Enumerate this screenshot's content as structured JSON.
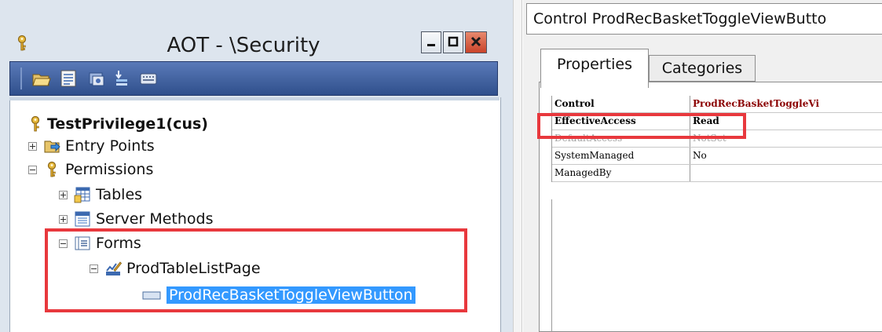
{
  "aot": {
    "title": "AOT - \\Security",
    "window_buttons": {
      "minimize": "minimize-icon",
      "maximize": "maximize-icon",
      "close": "close-icon"
    },
    "toolbar_icons": [
      "open-icon",
      "properties-icon",
      "compile-icon",
      "filter-icon",
      "keyboard-icon"
    ],
    "tree": [
      {
        "label": "TestPrivilege1(cus)",
        "icon": "key-icon"
      },
      {
        "label": "Entry Points",
        "icon": "entry-points-icon",
        "expander": "plus"
      },
      {
        "label": "Permissions",
        "icon": "key-icon",
        "expander": "minus"
      },
      {
        "label": "Tables",
        "icon": "tables-icon",
        "expander": "plus"
      },
      {
        "label": "Server Methods",
        "icon": "server-methods-icon",
        "expander": "plus"
      },
      {
        "label": "Forms",
        "icon": "forms-icon",
        "expander": "minus"
      },
      {
        "label": "ProdTableListPage",
        "icon": "form-design-icon",
        "expander": "minus"
      },
      {
        "label": "ProdRecBasketToggleViewButton",
        "icon": "control-icon",
        "selected": true
      }
    ]
  },
  "properties": {
    "header": "Control ProdRecBasketToggleViewButto",
    "tabs": [
      "Properties",
      "Categories"
    ],
    "active_tab": "Properties",
    "rows": [
      {
        "name": "Control",
        "value": "ProdRecBasketToggleVi"
      },
      {
        "name": "EffectiveAccess",
        "value": "Read"
      },
      {
        "name": "DefaultAccess",
        "value": "NotSet"
      },
      {
        "name": "SystemManaged",
        "value": "No"
      },
      {
        "name": "ManagedBy",
        "value": ""
      }
    ]
  },
  "colors": {
    "highlight_box": "#e8383d",
    "selection": "#3399ff",
    "toolbar": "#3d5d9e"
  }
}
